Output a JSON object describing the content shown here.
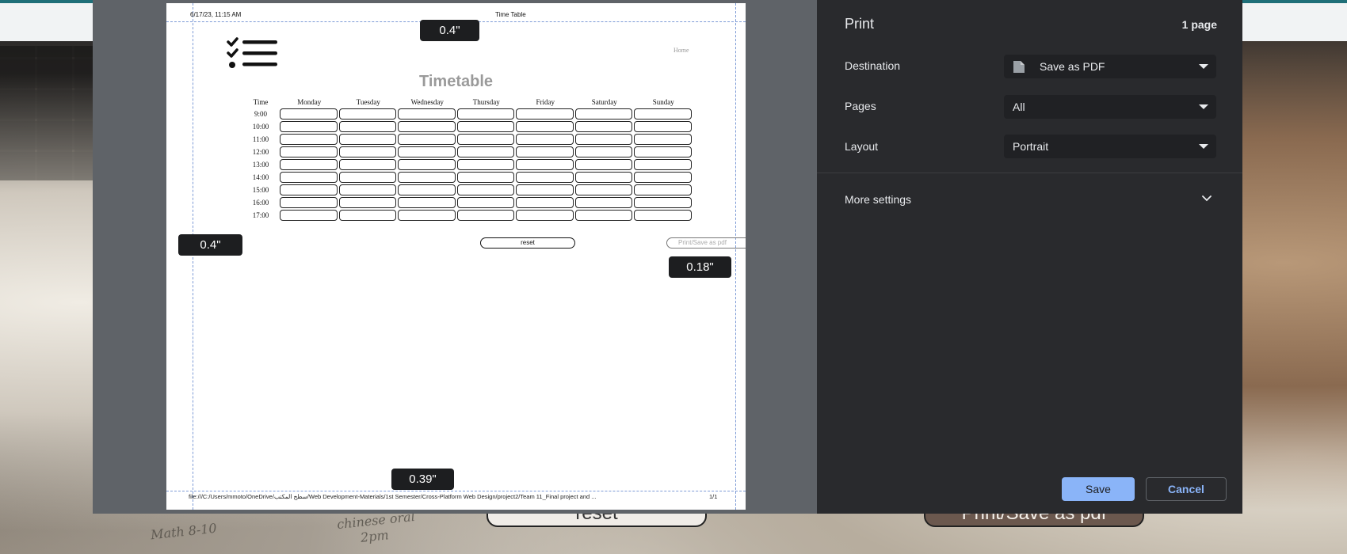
{
  "background": {
    "reset_label": "reset",
    "printsave_label": "Print/Save as pdf",
    "notes": [
      "Math 8-10",
      "chinese oral",
      "2pm"
    ]
  },
  "preview": {
    "header_left": "6/17/23, 11:15 AM",
    "header_center": "Time Table",
    "home_link": "Home",
    "title": "Timetable",
    "time_header": "Time",
    "days": [
      "Monday",
      "Tuesday",
      "Wednesday",
      "Thursday",
      "Friday",
      "Saturday",
      "Sunday"
    ],
    "times": [
      "9:00",
      "10:00",
      "11:00",
      "12:00",
      "13:00",
      "14:00",
      "15:00",
      "16:00",
      "17:00"
    ],
    "reset_label": "reset",
    "printsave_label": "Print/Save as pdf",
    "footer_path": "file:///C:/Users/mmoto/OneDrive/سطح المكتب/Web Development-Materials/1st Semester/Cross-Platform Web Design/project2/Team 11_Final project and ...",
    "footer_page": "1/1",
    "margins": {
      "top": "0.4\"",
      "left": "0.4\"",
      "right": "0.18\"",
      "bottom": "0.39\""
    }
  },
  "settings": {
    "title": "Print",
    "page_count": "1 page",
    "destination_label": "Destination",
    "destination_value": "Save as PDF",
    "pages_label": "Pages",
    "pages_value": "All",
    "layout_label": "Layout",
    "layout_value": "Portrait",
    "more_settings_label": "More settings",
    "save_label": "Save",
    "cancel_label": "Cancel"
  },
  "colors": {
    "accent": "#8ab4f8",
    "panel_bg": "#292a2d",
    "select_bg": "#202124",
    "preview_bg": "#5f6368",
    "margin_guide": "#7d9bd6"
  }
}
